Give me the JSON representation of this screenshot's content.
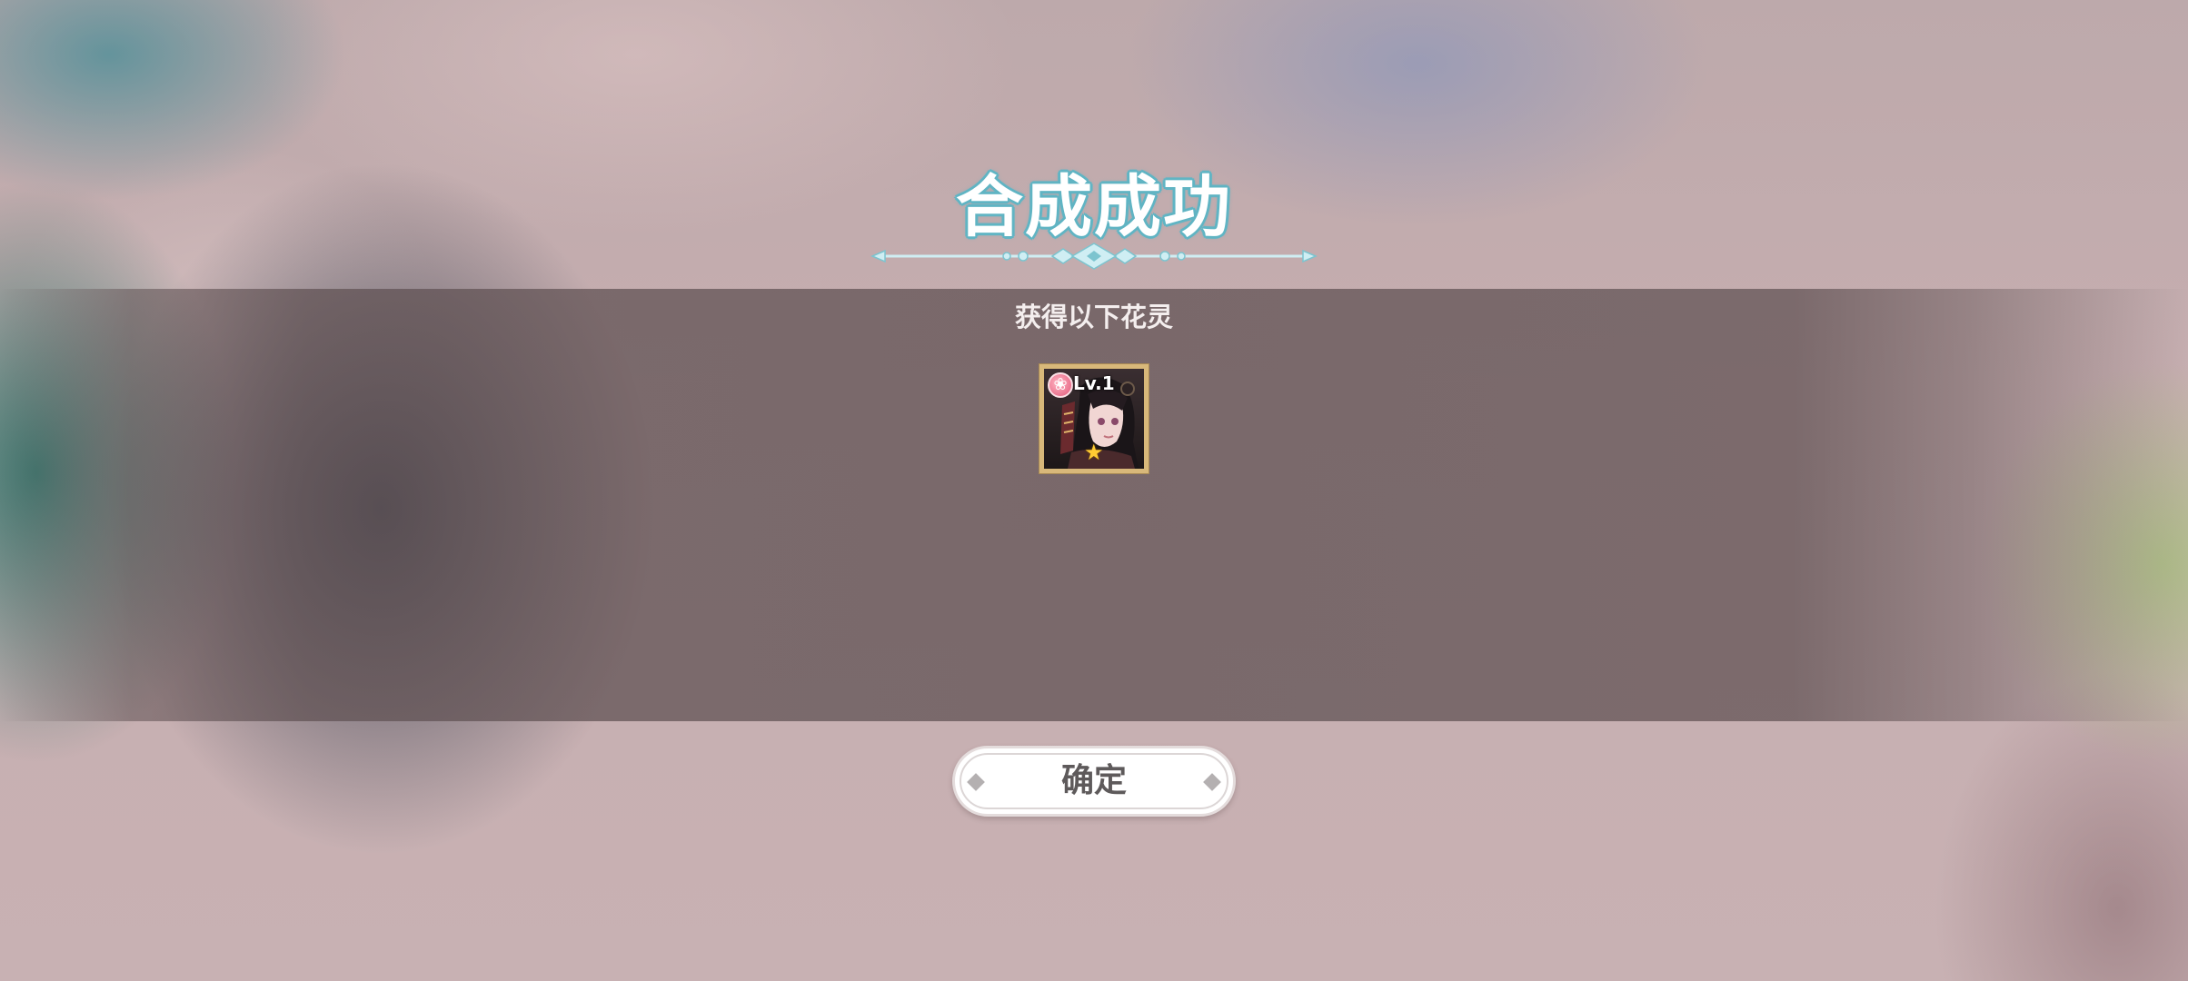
{
  "dialog": {
    "title": "合成成功",
    "subtitle": "获得以下花灵"
  },
  "reward": {
    "level_text": "Lv.1",
    "stars": 1,
    "element_icon": "flower-element-icon"
  },
  "buttons": {
    "confirm_label": "确定"
  },
  "colors": {
    "title_outline": "#63b6c5",
    "card_frame": "#d8b87a",
    "band": "#64555",
    "button_text": "#5e5a5b"
  }
}
